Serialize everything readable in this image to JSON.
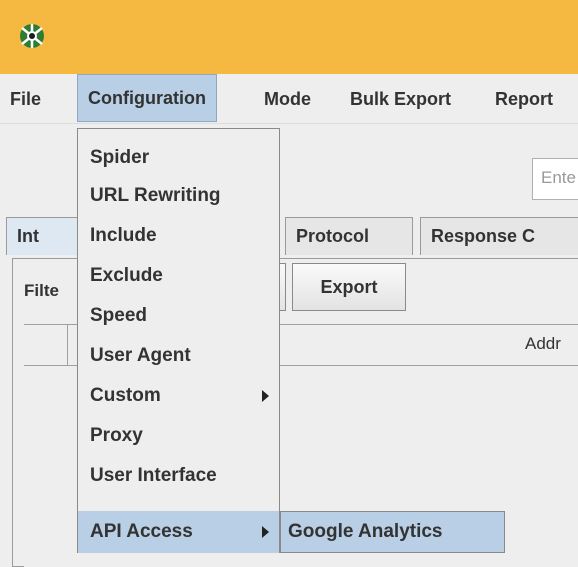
{
  "menubar": {
    "items": [
      {
        "label": "File"
      },
      {
        "label": "Configuration"
      },
      {
        "label": "Mode"
      },
      {
        "label": "Bulk Export"
      },
      {
        "label": "Report"
      }
    ]
  },
  "search": {
    "placeholder": "Ente"
  },
  "tabs": [
    {
      "label": "Int"
    },
    {
      "label": "Protocol"
    },
    {
      "label": "Response C"
    }
  ],
  "filter": {
    "label": "Filte"
  },
  "export_button": {
    "label": "Export"
  },
  "table": {
    "address_header": "Addr"
  },
  "config_menu": {
    "items": [
      {
        "label": "Spider"
      },
      {
        "label": "URL Rewriting"
      },
      {
        "label": "Include"
      },
      {
        "label": "Exclude"
      },
      {
        "label": "Speed"
      },
      {
        "label": "User Agent"
      },
      {
        "label": "Custom"
      },
      {
        "label": "Proxy"
      },
      {
        "label": "User Interface"
      },
      {
        "label": "API Access"
      }
    ]
  },
  "api_submenu": {
    "items": [
      {
        "label": "Google Analytics"
      }
    ]
  },
  "colors": {
    "titlebar": "#f5b942",
    "menu_highlight": "#b8cfe5"
  },
  "icons": {
    "app": "spider-logo-icon"
  }
}
